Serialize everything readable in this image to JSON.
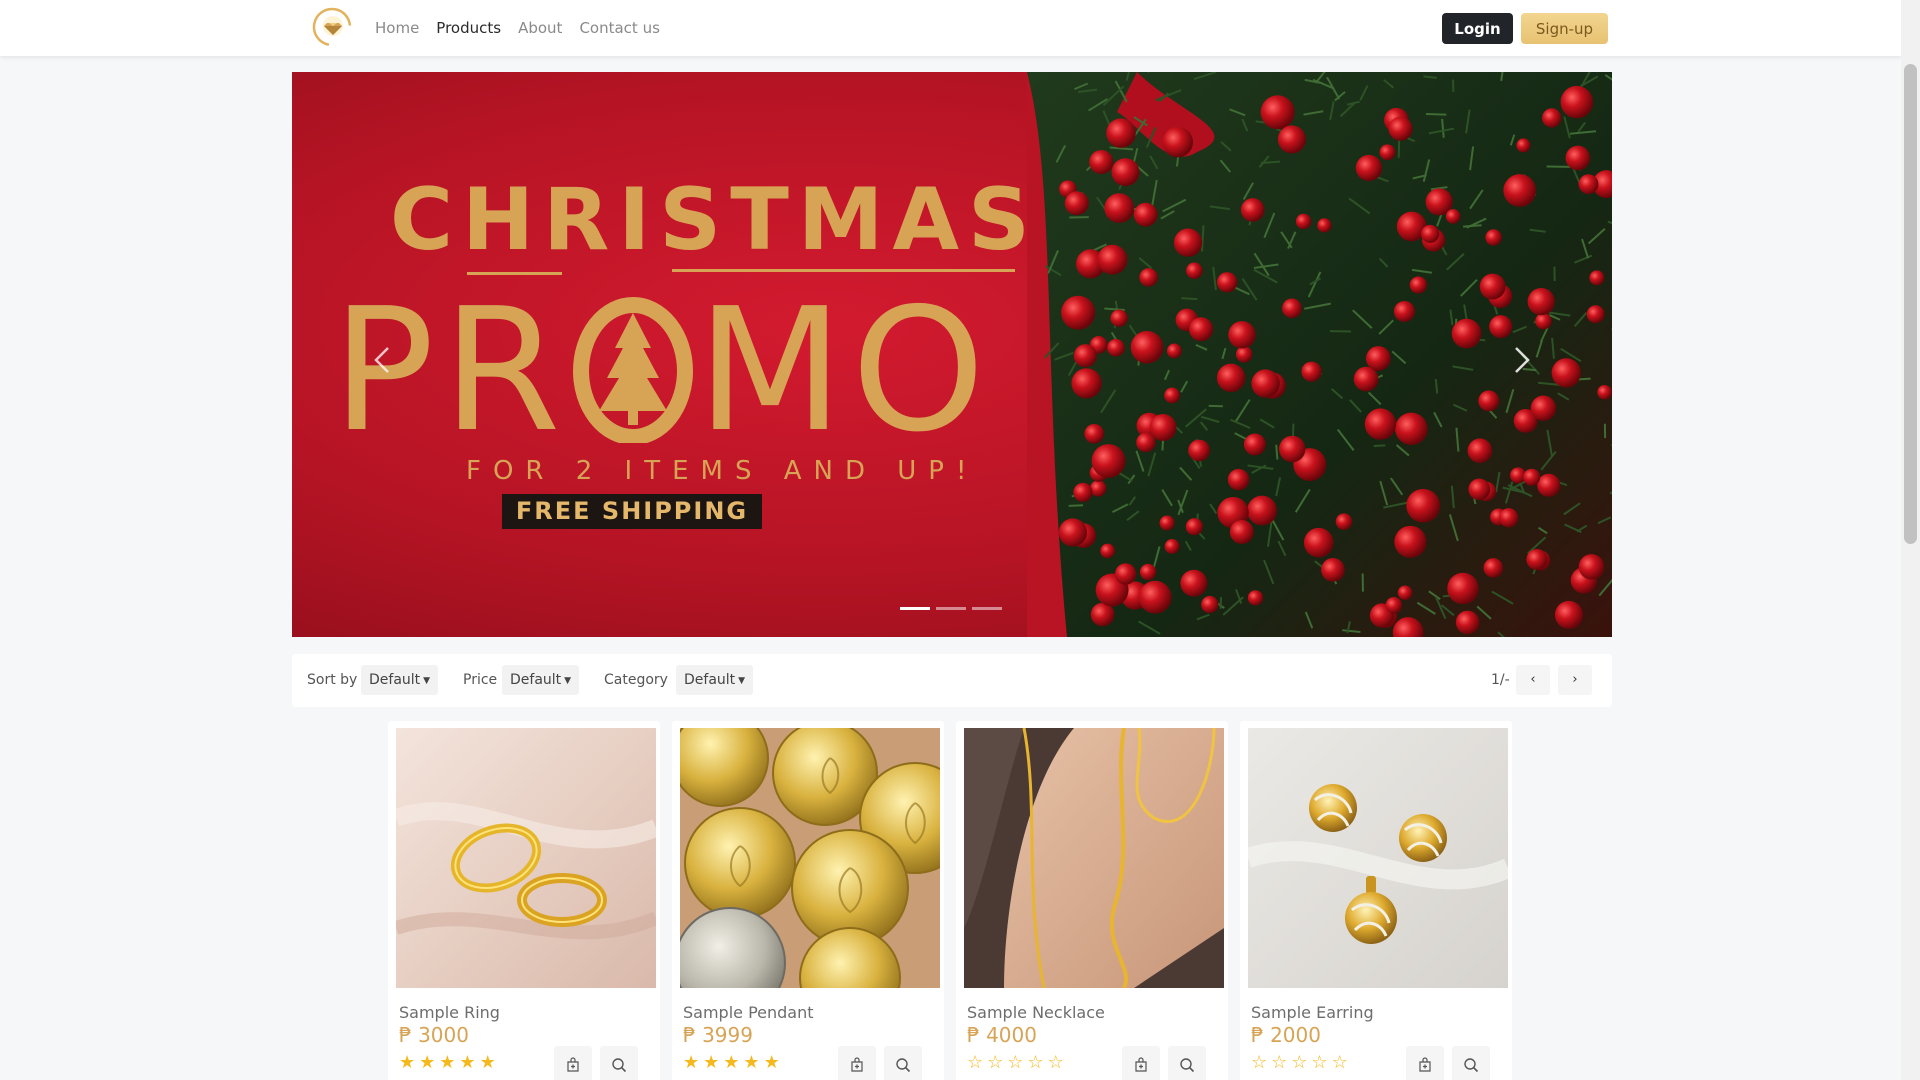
{
  "nav": {
    "logo_icon": "diamond-logo-icon",
    "links": [
      "Home",
      "Products",
      "About",
      "Contact us"
    ],
    "active_link": "Products",
    "login_label": "Login",
    "signup_label": "Sign-up"
  },
  "carousel": {
    "line1": "CHRISTMAS",
    "line2_left": "PR",
    "line2_right": "MO",
    "subtitle": "FOR 2 ITEMS AND UP!",
    "badge": "FREE SHIPPING",
    "slide_count": 3,
    "active_slide": 1,
    "prev_icon": "chevron-left-icon",
    "next_icon": "chevron-right-icon"
  },
  "filters": {
    "sort_label": "Sort by",
    "sort_value": "Default",
    "price_label": "Price",
    "price_value": "Default",
    "category_label": "Category",
    "category_value": "Default",
    "page_indicator": "1/-",
    "prev_icon": "chevron-left-icon",
    "next_icon": "chevron-right-icon"
  },
  "products": [
    {
      "name": "Sample Ring",
      "price": "₱ 3000",
      "rating": 5
    },
    {
      "name": "Sample Pendant",
      "price": "₱ 3999",
      "rating": 5
    },
    {
      "name": "Sample Necklace",
      "price": "₱ 4000",
      "rating": 0
    },
    {
      "name": "Sample Earring",
      "price": "₱ 2000",
      "rating": 0
    }
  ],
  "card_actions": {
    "cart_icon": "add-to-bag-icon",
    "view_icon": "magnify-icon"
  },
  "colors": {
    "gold": "#d7a456",
    "dark": "#212529",
    "promo_red": "#c4182a",
    "star": "#f4b91c"
  }
}
